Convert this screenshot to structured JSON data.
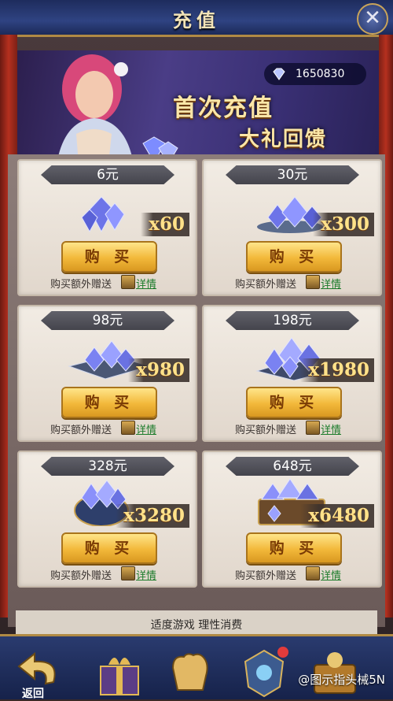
{
  "header": {
    "title": "充值",
    "close_label": "✕"
  },
  "balance": {
    "icon": "diamond-icon",
    "value": "1650830"
  },
  "banner": {
    "line1": "首次充值",
    "line2": "大礼回馈"
  },
  "packages": [
    {
      "price": "6元",
      "quantity": "x60",
      "buy_label": "购 买",
      "bonus_text": "购买额外赠送",
      "detail_label": "详情"
    },
    {
      "price": "30元",
      "quantity": "x300",
      "buy_label": "购 买",
      "bonus_text": "购买额外赠送",
      "detail_label": "详情"
    },
    {
      "price": "98元",
      "quantity": "x980",
      "buy_label": "购 买",
      "bonus_text": "购买额外赠送",
      "detail_label": "详情"
    },
    {
      "price": "198元",
      "quantity": "x1980",
      "buy_label": "购 买",
      "bonus_text": "购买额外赠送",
      "detail_label": "详情"
    },
    {
      "price": "328元",
      "quantity": "x3280",
      "buy_label": "购 买",
      "bonus_text": "购买额外赠送",
      "detail_label": "详情"
    },
    {
      "price": "648元",
      "quantity": "x6480",
      "buy_label": "购 买",
      "bonus_text": "购买额外赠送",
      "detail_label": "详情"
    }
  ],
  "footer": {
    "slogan": "适度游戏   理性消费"
  },
  "bottom_nav": {
    "back_label": "返回"
  },
  "watermark": "@图示指头械5N",
  "colors": {
    "title_bar": "#2f4382",
    "gold_button": "#f2b83a",
    "detail_link": "#1b7b2a",
    "price_tag": "#55555e",
    "quantity_text": "#ffe28a"
  }
}
